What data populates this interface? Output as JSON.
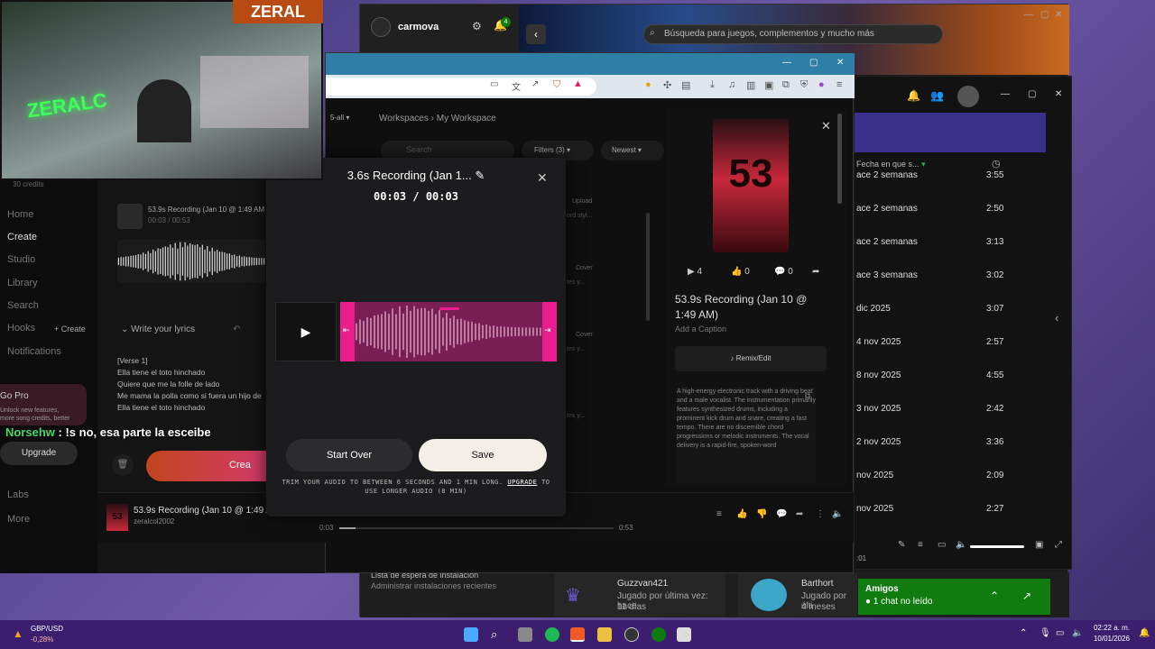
{
  "xbox": {
    "username": "carmova",
    "notification_count": "4",
    "search_placeholder": "Búsqueda para juegos, complementos y mucho más",
    "install_queue_title": "Lista de espera de instalación",
    "install_queue_sub": "Administrar instalaciones recientes",
    "friend1_name": "Guzzvan421",
    "friend1_status": "Jugado por última vez: hace",
    "friend1_time": "11 días",
    "friend2_name": "Barthort",
    "friend2_status": "Jugado por últi",
    "friend2_time": "4 meses",
    "amigos_title": "Amigos",
    "amigos_sub": "1 chat no leído"
  },
  "spotify": {
    "header_col": "Fecha en que s...",
    "rows": [
      {
        "date": "ace 2 semanas",
        "dur": "3:55"
      },
      {
        "date": "ace 2 semanas",
        "dur": "2:50"
      },
      {
        "date": "ace 2 semanas",
        "dur": "3:13"
      },
      {
        "date": "ace 3 semanas",
        "dur": "3:02"
      },
      {
        "date": "dic 2025",
        "dur": "3:07"
      },
      {
        "date": "4 nov 2025",
        "dur": "2:57"
      },
      {
        "date": "8 nov 2025",
        "dur": "4:55"
      },
      {
        "date": "3 nov 2025",
        "dur": "2:42"
      },
      {
        "date": "2 nov 2025",
        "dur": "3:36"
      },
      {
        "date": "nov 2025",
        "dur": "2:09"
      },
      {
        "date": "nov 2025",
        "dur": "2:27"
      }
    ],
    "time_left": ":01"
  },
  "app": {
    "credits": "30 credits",
    "nav": [
      "Home",
      "Create",
      "Studio",
      "Library",
      "Search",
      "Hooks",
      "Notifications",
      "Labs",
      "More"
    ],
    "hooks_create": "+ Create",
    "go_pro": "Go Pro",
    "go_pro_text1": "Unlock new features,",
    "go_pro_text2": "more song credits, better",
    "upgrade": "Upgrade",
    "create_btn": "Crea",
    "clip_title": "53.9s Recording (Jan 10 @ 1:49 AM",
    "clip_time": "00:03 / 00:53",
    "lyrics_header": "Write your lyrics",
    "lyrics": [
      "[Verse 1]",
      "Ella tiene el toto hinchado",
      "Quiere que me la folle de lado",
      "Me mama la polla como si fuera un hijo de",
      "Ella tiene el toto hinchado"
    ],
    "crumb_workspaces": "Workspaces",
    "crumb_sep": "›",
    "crumb_current": "My Workspace",
    "filter_all": "5-all",
    "search_placeholder": "Search",
    "filters": "Filters (3)",
    "sort": "Newest",
    "list_tags": [
      "Upload",
      "Cover",
      "Cover"
    ],
    "list_snips": [
      "ord styl...",
      "tes y...",
      "tes y...",
      "tes y..."
    ]
  },
  "modal": {
    "title": "3.6s Recording (Jan 1...",
    "time": "00:03 / 00:03",
    "start_over": "Start Over",
    "save": "Save",
    "trim_note_1": "TRIM YOUR AUDIO TO BETWEEN 6 SECONDS AND 1 MIN LONG. ",
    "trim_link": "UPGRADE",
    "trim_note_2": " TO USE LONGER AUDIO (8 MIN)"
  },
  "detail": {
    "cover_text": "53",
    "plays": "4",
    "likes": "0",
    "comments": "0",
    "title": "53.9s Recording (Jan 10 @ 1:49 AM)",
    "caption": "Add a Caption",
    "remix": "Remix/Edit",
    "description": "A high-energy electronic track with a driving beat and a male vocalist. The instrumentation primarily features synthesized drums, including a prominent kick drum and snare, creating a fast tempo. There are no discernible chord progressions or melodic instruments. The vocal delivery is a rapid-fire, spoken-word"
  },
  "player": {
    "title": "53.9s Recording (Jan 10 @ 1:49 AM)",
    "artist": "zeralcol2002",
    "cover_text": "53",
    "time_start": "0:03",
    "time_end": "0:53",
    "progress": 0.06
  },
  "stream": {
    "tag": "ZERAL",
    "neon": "ZERALC",
    "chat_user": "Norsehw",
    "chat_text": " : !s no, esa parte la esceibe"
  },
  "taskbar": {
    "ticker": "GBP/USD",
    "ticker_change": "-0,28%",
    "clock_time": "02:22 a. m.",
    "clock_date": "10/01/2026"
  },
  "colors": {
    "accent_pink": "#e91e8c",
    "xbox_green": "#107c10",
    "taskbar": "#3b1f6e"
  }
}
